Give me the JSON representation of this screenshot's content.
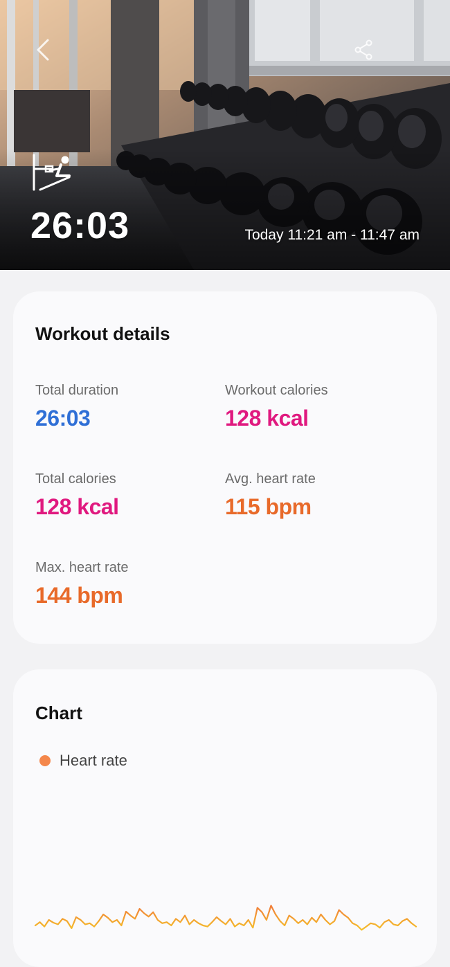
{
  "header": {
    "duration": "26:03",
    "time_range": "Today 11:21 am - 11:47 am",
    "back_icon": "chevron-left-icon",
    "share_icon": "share-icon",
    "workout_icon": "rowing-machine-icon"
  },
  "details": {
    "title": "Workout details",
    "stats": [
      {
        "label": "Total duration",
        "value": "26:03",
        "color": "#2f6fd6"
      },
      {
        "label": "Workout calories",
        "value": "128 kcal",
        "color": "#e0197f"
      },
      {
        "label": "Total calories",
        "value": "128 kcal",
        "color": "#e0197f"
      },
      {
        "label": "Avg. heart rate",
        "value": "115 bpm",
        "color": "#e86a2a"
      },
      {
        "label": "Max. heart rate",
        "value": "144 bpm",
        "color": "#e86a2a"
      }
    ]
  },
  "chart_section": {
    "title": "Chart",
    "legend_label": "Heart rate",
    "legend_color": "#f4874b"
  },
  "chart_data": {
    "type": "line",
    "series": [
      {
        "name": "Heart rate",
        "values": [
          60,
          66,
          58,
          70,
          65,
          62,
          72,
          68,
          55,
          75,
          70,
          62,
          64,
          58,
          68,
          80,
          74,
          66,
          70,
          60,
          85,
          78,
          72,
          90,
          82,
          76,
          84,
          70,
          64,
          66,
          60,
          72,
          66,
          78,
          62,
          70,
          64,
          60,
          58,
          66,
          75,
          68,
          62,
          72,
          58,
          64,
          60,
          70,
          56,
          92,
          84,
          70,
          96,
          80,
          68,
          60,
          78,
          72,
          64,
          70,
          62,
          74,
          66,
          80,
          70,
          62,
          68,
          88,
          80,
          74,
          64,
          60,
          52,
          58,
          64,
          62,
          56,
          66,
          70,
          62,
          60,
          68,
          72,
          64,
          58
        ]
      }
    ]
  }
}
